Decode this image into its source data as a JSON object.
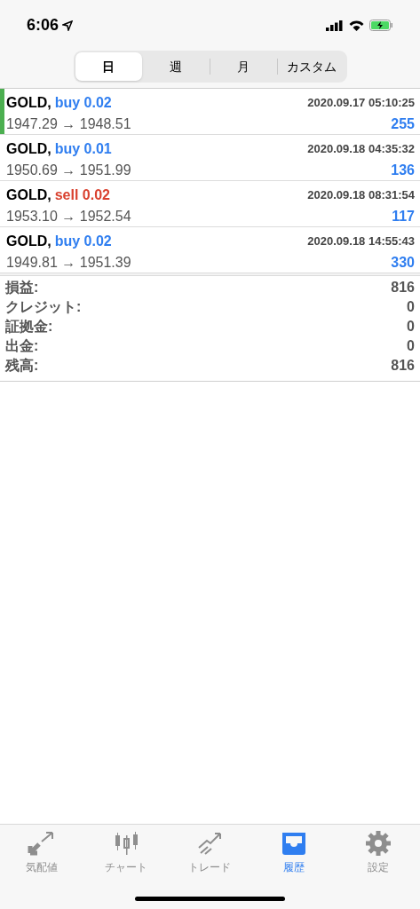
{
  "status_bar": {
    "time": "6:06"
  },
  "segments": [
    {
      "label": "日",
      "selected": true
    },
    {
      "label": "週",
      "selected": false
    },
    {
      "label": "月",
      "selected": false
    },
    {
      "label": "カスタム",
      "selected": false
    }
  ],
  "trades": [
    {
      "symbol": "GOLD,",
      "kind": "buy",
      "order": "buy 0.02",
      "time": "2020.09.17 05:10:25",
      "prices": "1947.29 → 1948.51",
      "profit": "255",
      "selected": true
    },
    {
      "symbol": "GOLD,",
      "kind": "buy",
      "order": "buy 0.01",
      "time": "2020.09.18 04:35:32",
      "prices": "1950.69 → 1951.99",
      "profit": "136",
      "selected": false
    },
    {
      "symbol": "GOLD,",
      "kind": "sell",
      "order": "sell 0.02",
      "time": "2020.09.18 08:31:54",
      "prices": "1953.10 → 1952.54",
      "profit": "117",
      "selected": false
    },
    {
      "symbol": "GOLD,",
      "kind": "buy",
      "order": "buy 0.02",
      "time": "2020.09.18 14:55:43",
      "prices": "1949.81 → 1951.39",
      "profit": "330",
      "selected": false
    }
  ],
  "summary": [
    {
      "label": "損益:",
      "value": "816"
    },
    {
      "label": "クレジット:",
      "value": "0"
    },
    {
      "label": "証拠金:",
      "value": "0"
    },
    {
      "label": "出金:",
      "value": "0"
    },
    {
      "label": "残高:",
      "value": "816"
    }
  ],
  "tab_bar": [
    {
      "kind": "quotes",
      "label": "気配値",
      "selected": false
    },
    {
      "kind": "chart",
      "label": "チャート",
      "selected": false
    },
    {
      "kind": "trade",
      "label": "トレード",
      "selected": false
    },
    {
      "kind": "history",
      "label": "履歴",
      "selected": true
    },
    {
      "kind": "settings",
      "label": "設定",
      "selected": false
    }
  ]
}
